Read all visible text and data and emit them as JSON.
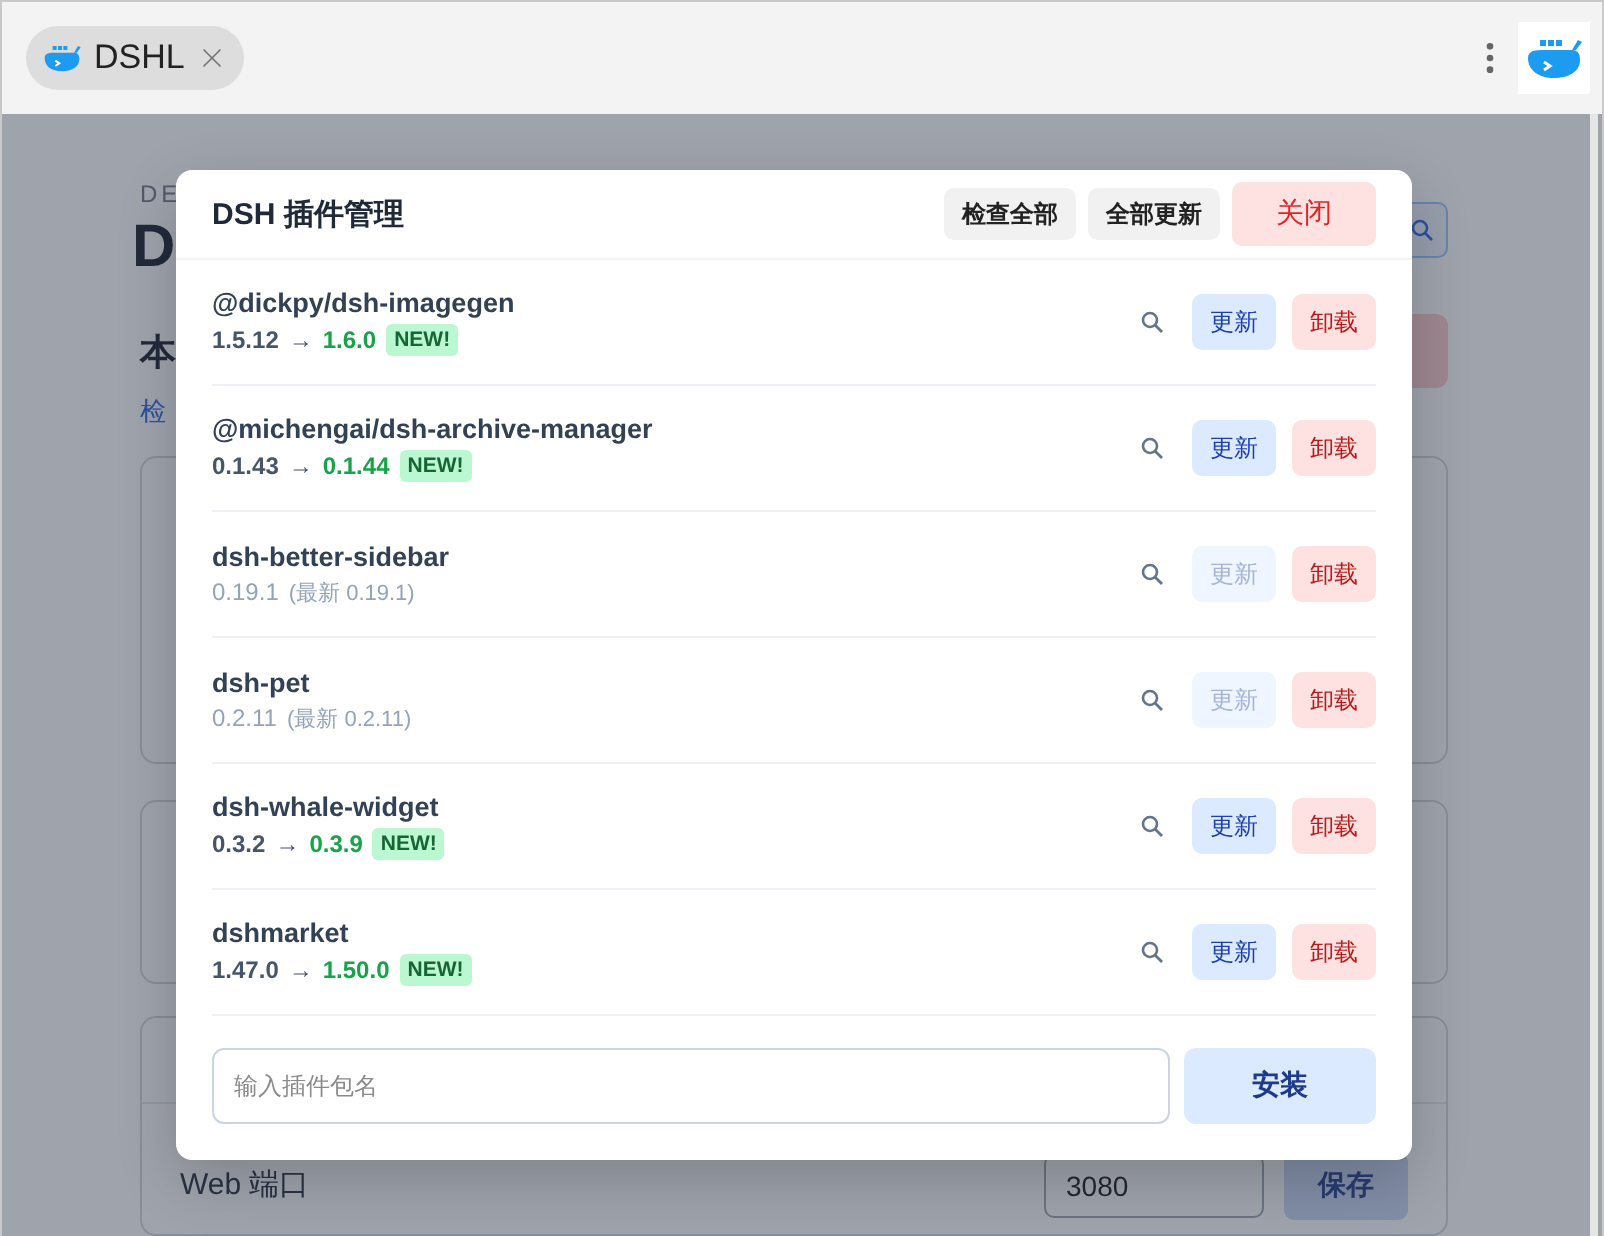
{
  "browser": {
    "tab": {
      "title": "DSHL",
      "selected": true
    }
  },
  "background_page": {
    "eyebrow": "DE",
    "title": "D",
    "section_heading": "本",
    "link": "检",
    "setting": {
      "label": "Web 端口",
      "value": "3080",
      "button": "保存"
    }
  },
  "dialog": {
    "title": "DSH 插件管理",
    "buttons": [
      {
        "label": "检查全部",
        "kind": "neutral"
      },
      {
        "label": "全部更新",
        "kind": "neutral"
      },
      {
        "label": "关闭",
        "kind": "danger"
      }
    ],
    "plugins": [
      {
        "name": "@dickpy/dsh-imagegen",
        "current": "1.5.12",
        "arrow": "→",
        "latest": "1.6.0",
        "badge": "NEW!",
        "has_update": true,
        "update_label": "更新",
        "uninstall_label": "卸载"
      },
      {
        "name": "@michengai/dsh-archive-manager",
        "current": "0.1.43",
        "arrow": "→",
        "latest": "0.1.44",
        "badge": "NEW!",
        "has_update": true,
        "update_label": "更新",
        "uninstall_label": "卸载"
      },
      {
        "name": "dsh-better-sidebar",
        "current": "0.19.1",
        "latest_note": "(最新 0.19.1)",
        "has_update": false,
        "update_label": "更新",
        "uninstall_label": "卸载"
      },
      {
        "name": "dsh-pet",
        "current": "0.2.11",
        "latest_note": "(最新 0.2.11)",
        "has_update": false,
        "update_label": "更新",
        "uninstall_label": "卸载"
      },
      {
        "name": "dsh-whale-widget",
        "current": "0.3.2",
        "arrow": "→",
        "latest": "0.3.9",
        "badge": "NEW!",
        "has_update": true,
        "update_label": "更新",
        "uninstall_label": "卸载"
      },
      {
        "name": "dshmarket",
        "current": "1.47.0",
        "arrow": "→",
        "latest": "1.50.0",
        "badge": "NEW!",
        "has_update": true,
        "update_label": "更新",
        "uninstall_label": "卸载"
      }
    ],
    "install": {
      "placeholder": "输入插件包名",
      "button": "安装"
    }
  }
}
